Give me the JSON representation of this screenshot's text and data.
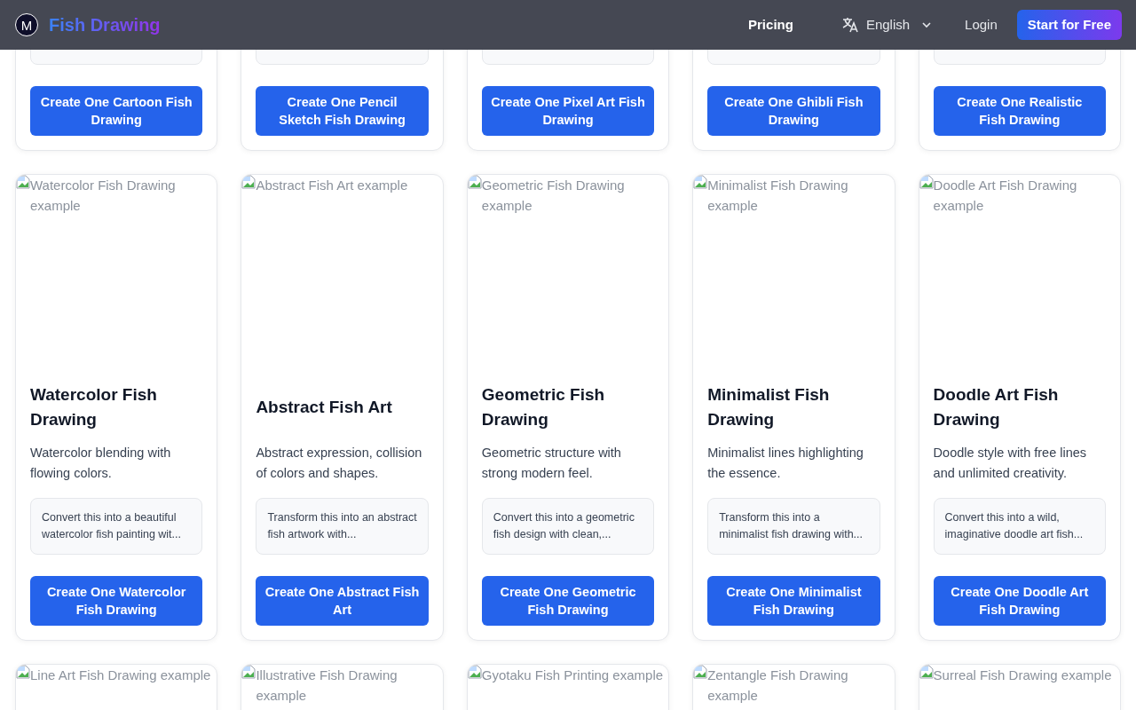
{
  "navbar": {
    "logo_letter": "M",
    "brand": "Fish Drawing",
    "links": [
      {
        "label": "Pricing"
      }
    ],
    "language": {
      "label": "English"
    },
    "login": "Login",
    "cta": "Start for Free"
  },
  "top_row": [
    {
      "button": "Create One Cartoon Fish Drawing"
    },
    {
      "button": "Create One Pencil Sketch Fish Drawing"
    },
    {
      "button": "Create One Pixel Art Fish Drawing"
    },
    {
      "button": "Create One Ghibli Fish Drawing"
    },
    {
      "button": "Create One Realistic Fish Drawing"
    }
  ],
  "cards": [
    {
      "image_alt": "Watercolor Fish Drawing example",
      "title": "Watercolor Fish Drawing",
      "description": "Watercolor blending with flowing colors.",
      "prompt": "Convert this into a beautiful watercolor fish painting wit...",
      "button": "Create One Watercolor Fish Drawing"
    },
    {
      "image_alt": "Abstract Fish Art example",
      "title": "Abstract Fish Art",
      "description": "Abstract expression, collision of colors and shapes.",
      "prompt": "Transform this into an abstract fish artwork with...",
      "button": "Create One Abstract Fish Art"
    },
    {
      "image_alt": "Geometric Fish Drawing example",
      "title": "Geometric Fish Drawing",
      "description": "Geometric structure with strong modern feel.",
      "prompt": "Convert this into a geometric fish design with clean,...",
      "button": "Create One Geometric Fish Drawing"
    },
    {
      "image_alt": "Minimalist Fish Drawing example",
      "title": "Minimalist Fish Drawing",
      "description": "Minimalist lines highlighting the essence.",
      "prompt": "Transform this into a minimalist fish drawing with...",
      "button": "Create One Minimalist Fish Drawing"
    },
    {
      "image_alt": "Doodle Art Fish Drawing example",
      "title": "Doodle Art Fish Drawing",
      "description": "Doodle style with free lines and unlimited creativity.",
      "prompt": "Convert this into a wild, imaginative doodle art fish...",
      "button": "Create One Doodle Art Fish Drawing"
    }
  ],
  "bottom_row": [
    {
      "image_alt": "Line Art Fish Drawing example"
    },
    {
      "image_alt": "Illustrative Fish Drawing example"
    },
    {
      "image_alt": "Gyotaku Fish Printing example"
    },
    {
      "image_alt": "Zentangle Fish Drawing example"
    },
    {
      "image_alt": "Surreal Fish Drawing example"
    }
  ]
}
